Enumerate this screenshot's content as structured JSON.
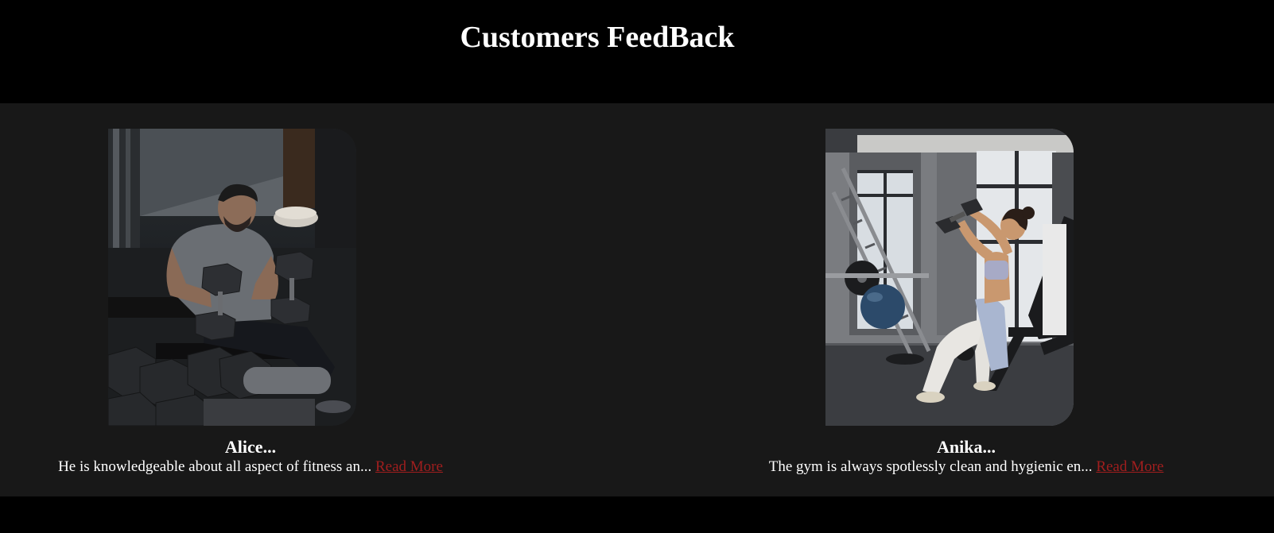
{
  "header": {
    "title": "Customers FeedBack"
  },
  "feedback": [
    {
      "name": "Alice...",
      "text": "He is knowledgeable about all aspect of fitness an...",
      "link": "Read More",
      "photo_icon": "man-lifting-dumbbells-photo"
    },
    {
      "name": "Anika...",
      "text": "The gym is always spotlessly clean and hygienic en...",
      "link": "Read More",
      "photo_icon": "woman-exercising-photo"
    }
  ],
  "colors": {
    "header_bg": "#000000",
    "section_bg": "#181818",
    "link": "#a01e1e",
    "text": "#ffffff"
  }
}
